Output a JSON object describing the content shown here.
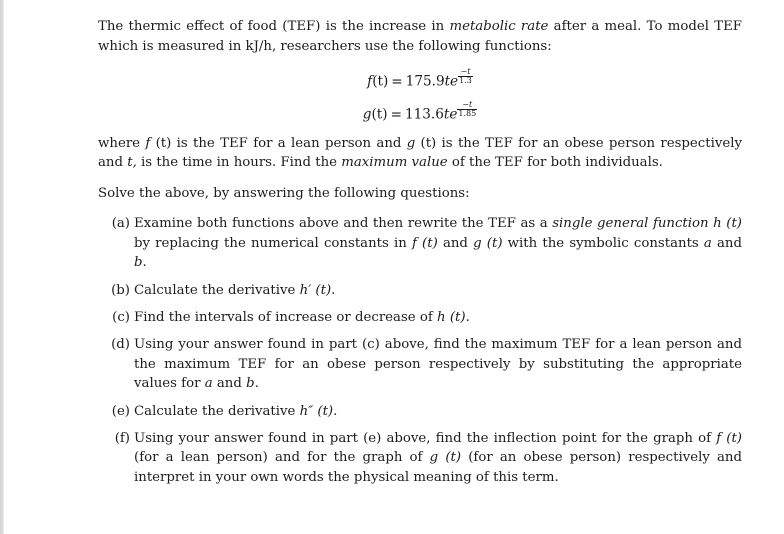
{
  "document": {
    "intro": {
      "seg1": "The thermic effect of food (TEF) is the increase in ",
      "emphasis1": "metabolic rate",
      "seg2": " after a meal. To model TEF which is measured in kJ/h, researchers use the following functions:"
    },
    "equations": [
      {
        "name": "f-equation",
        "lhs_fn": "f",
        "lhs_arg": "(t)",
        "equals": "=",
        "coefficient": "175.9",
        "variable": "te",
        "exp_numerator": "−t",
        "exp_denominator": "1.3",
        "plain": "f (t) = 175.9te^(-t/1.3)"
      },
      {
        "name": "g-equation",
        "lhs_fn": "g",
        "lhs_arg": "(t)",
        "equals": "=",
        "coefficient": "113.6",
        "variable": "te",
        "exp_numerator": "−t",
        "exp_denominator": "1.85",
        "plain": "g (t) = 113.6te^(-t/1.85)"
      }
    ],
    "where_clause": {
      "seg1": "where ",
      "fn1": "f",
      "arg1": " (t)",
      "seg2": " is the TEF for a lean person and ",
      "fn2": "g",
      "arg2": " (t)",
      "seg3": " is the TEF for an obese person respectively and ",
      "var_t": "t,",
      "seg4": " is the time in hours. Find the ",
      "emphasis": "maximum value",
      "seg5": " of the TEF for both individuals."
    },
    "instruction": "Solve the above, by answering the following questions:",
    "questions": [
      {
        "label": "(a)",
        "name": "question-a",
        "seg1": "Examine both functions above and then rewrite the TEF as a ",
        "emphasis": "single general function",
        "seg2": " h (t)",
        "seg3": " by replacing the numerical constants in ",
        "fn1": "f (t)",
        "seg4": " and ",
        "fn2": "g (t)",
        "seg5": " with the symbolic constants ",
        "const1": "a",
        "seg6": " and ",
        "const2": "b",
        "seg7": ".",
        "plain": "Examine both functions above and then rewrite the TEF as a single general function h (t) by replacing the numerical constants in f (t) and g (t) with the symbolic constants a and b."
      },
      {
        "label": "(b)",
        "name": "question-b",
        "seg1": "Calculate the derivative ",
        "math": "h′ (t)",
        "seg2": ".",
        "plain": "Calculate the derivative h' (t)."
      },
      {
        "label": "(c)",
        "name": "question-c",
        "seg1": "Find the intervals of increase or decrease of ",
        "math": "h (t)",
        "seg2": ".",
        "plain": "Find the intervals of increase or decrease of h (t)."
      },
      {
        "label": "(d)",
        "name": "question-d",
        "seg1": "Using your answer found in part (c) above, find the maximum TEF for a lean person and the maximum TEF for an obese person respectively by substituting the appropriate values for ",
        "const1": "a",
        "seg2": " and ",
        "const2": "b",
        "seg3": ".",
        "plain": "Using your answer found in part (c) above, find the maximum TEF for a lean person and the maximum TEF for an obese person respectively by substituting the appropriate values for a and b."
      },
      {
        "label": "(e)",
        "name": "question-e",
        "seg1": "Calculate the derivative ",
        "math": "h″ (t)",
        "seg2": ".",
        "plain": "Calculate the derivative h'' (t)."
      },
      {
        "label": "(f)",
        "name": "question-f",
        "seg1": "Using your answer found in part (e) above, find the inflection point for the graph of ",
        "fn1": "f (t)",
        "seg2": " (for a lean person) and for the graph of ",
        "fn2": "g (t)",
        "seg3": " (for an obese person) respectively and interpret in your own words the physical meaning of this term.",
        "plain": "Using your answer found in part (e) above, find the inflection point for the graph of f (t) (for a lean person) and for the graph of g (t) (for an obese person) respectively and interpret in your own words the physical meaning of this term."
      }
    ]
  },
  "colors": {
    "page_background": "#ffffff",
    "text": "#1c1c1c",
    "left_edge_strip": "#d6d6d6"
  }
}
